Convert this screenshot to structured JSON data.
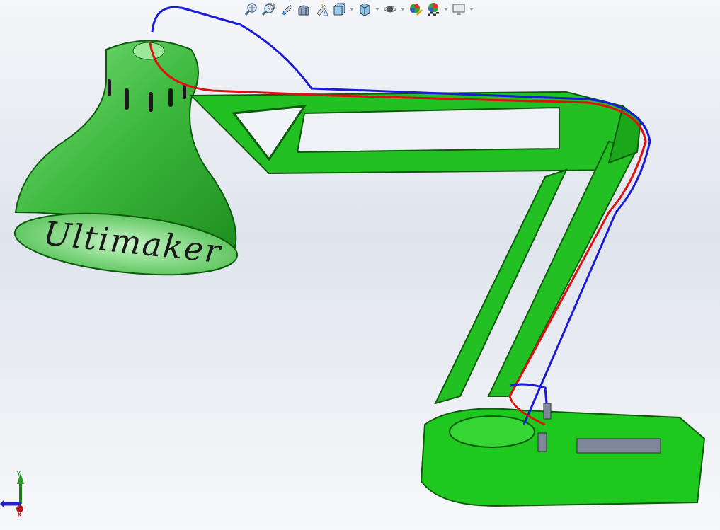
{
  "toolbar": {
    "items": [
      {
        "kind": "fit",
        "menu": false
      },
      {
        "kind": "area",
        "menu": false
      },
      {
        "kind": "previous",
        "menu": false
      },
      {
        "kind": "section",
        "menu": false
      },
      {
        "kind": "annotation",
        "menu": false
      },
      {
        "kind": "orientation",
        "menu": true
      },
      {
        "kind": "display",
        "menu": true
      },
      {
        "kind": "visibility",
        "menu": true
      },
      {
        "kind": "appearance",
        "menu": false
      },
      {
        "kind": "scene",
        "menu": true
      },
      {
        "kind": "settings",
        "menu": true
      }
    ]
  },
  "model": {
    "engraving": "Ultimaker"
  },
  "triad": {
    "axes": [
      {
        "kind": "y",
        "label": "Y"
      },
      {
        "kind": "x",
        "label": "X"
      }
    ]
  }
}
